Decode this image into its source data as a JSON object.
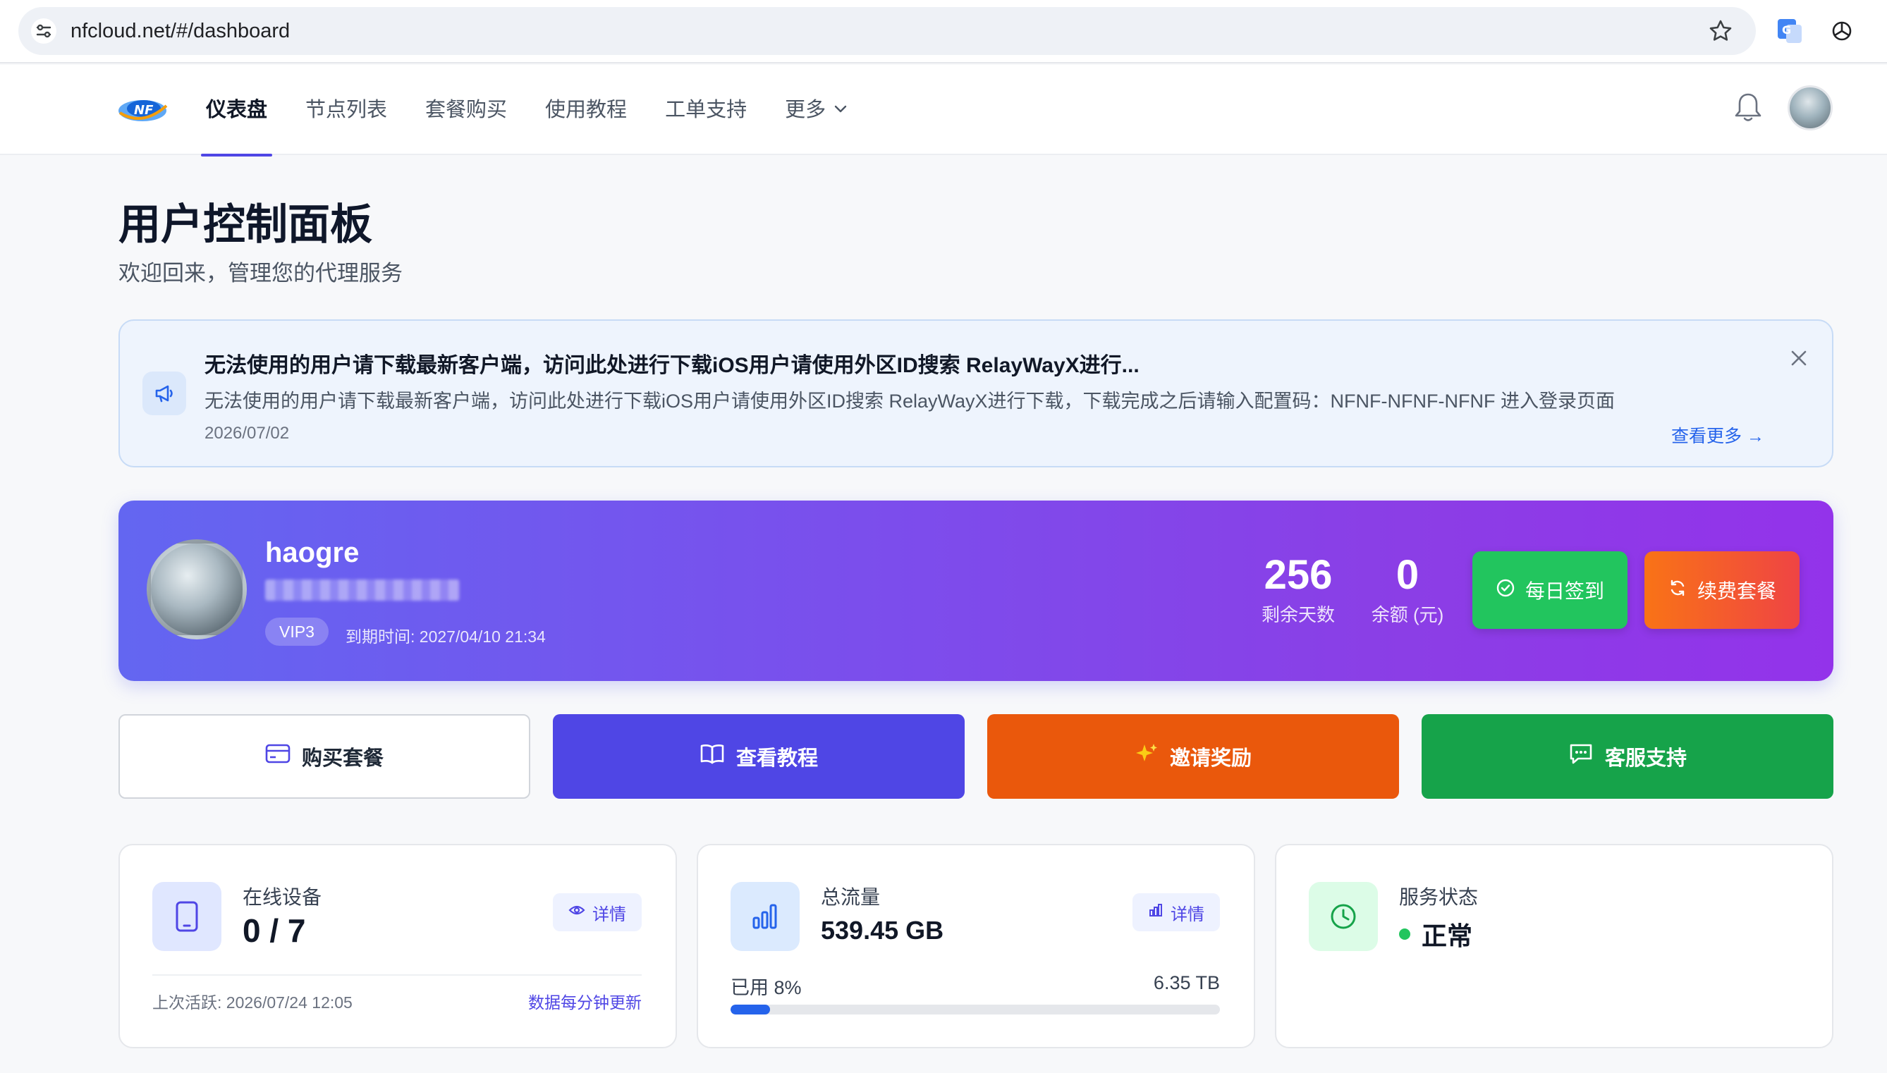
{
  "browser": {
    "url": "nfcloud.net/#/dashboard"
  },
  "nav": {
    "items": [
      {
        "label": "仪表盘",
        "active": true
      },
      {
        "label": "节点列表",
        "active": false
      },
      {
        "label": "套餐购买",
        "active": false
      },
      {
        "label": "使用教程",
        "active": false
      },
      {
        "label": "工单支持",
        "active": false
      },
      {
        "label": "更多",
        "active": false
      }
    ]
  },
  "page": {
    "title": "用户控制面板",
    "subtitle": "欢迎回来，管理您的代理服务"
  },
  "notice": {
    "title": "无法使用的用户请下载最新客户端，访问此处进行下载iOS用户请使用外区ID搜索 RelayWayX进行...",
    "body": "无法使用的用户请下载最新客户端，访问此处进行下载iOS用户请使用外区ID搜索 RelayWayX进行下载，下载完成之后请输入配置码：NFNF-NFNF-NFNF 进入登录页面",
    "date": "2026/07/02",
    "more_label": "查看更多 →"
  },
  "user": {
    "name": "haogre",
    "vip": "VIP3",
    "expire": "到期时间: 2027/04/10 21:34",
    "days_left": "256",
    "days_left_label": "剩余天数",
    "balance": "0",
    "balance_label": "余额 (元)",
    "checkin_label": "每日签到",
    "renew_label": "续费套餐"
  },
  "actions": {
    "buy": "购买套餐",
    "tutorial": "查看教程",
    "invite": "邀请奖励",
    "support": "客服支持"
  },
  "cards": {
    "devices": {
      "label": "在线设备",
      "value": "0 / 7",
      "detail": "详情",
      "last_active": "上次活跃: 2026/07/24 12:05",
      "update_note": "数据每分钟更新"
    },
    "traffic": {
      "label": "总流量",
      "value": "539.45 GB",
      "detail": "详情",
      "used_label": "已用 8%",
      "used_fraction": 0.08,
      "total": "6.35 TB"
    },
    "service": {
      "label": "服务状态",
      "value": "正常",
      "status_color": "#22c55e"
    }
  },
  "colors": {
    "accent": "#4f46e5",
    "invite": "#ea580c",
    "support": "#16a34a",
    "checkin": "#22c55e"
  }
}
